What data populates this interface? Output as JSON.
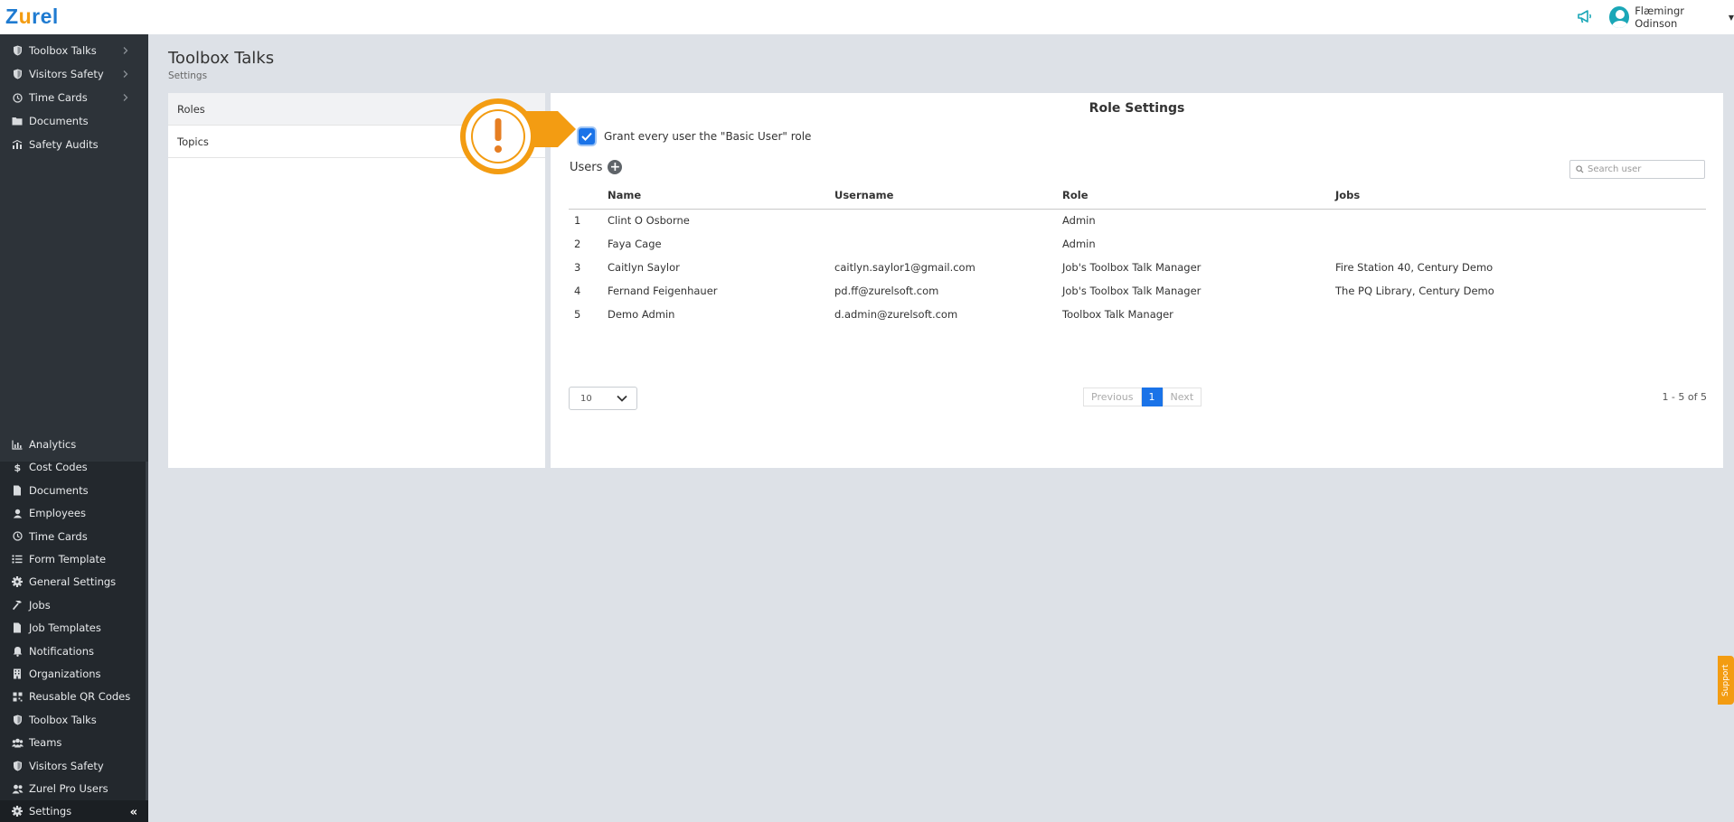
{
  "app": {
    "logo": "Zurel",
    "logo_pre": "Z",
    "logo_dot": "u",
    "logo_post": "rel"
  },
  "header": {
    "user_name": "Flæmingr Odinson",
    "icon": "megaphone-icon"
  },
  "sidebar": {
    "top_items": [
      {
        "label": "Toolbox Talks",
        "icon": "shield-icon",
        "has_children": true
      },
      {
        "label": "Visitors Safety",
        "icon": "shield-icon",
        "has_children": true
      },
      {
        "label": "Time Cards",
        "icon": "clock-icon",
        "has_children": true
      },
      {
        "label": "Documents",
        "icon": "folder-icon",
        "has_children": false
      },
      {
        "label": "Safety Audits",
        "icon": "audit-icon",
        "has_children": false
      }
    ],
    "bottom_items": [
      {
        "label": "Analytics",
        "icon": "chart-icon"
      },
      {
        "label": "Cost Codes",
        "icon": "dollar-icon"
      },
      {
        "label": "Documents",
        "icon": "file-icon"
      },
      {
        "label": "Employees",
        "icon": "user-icon"
      },
      {
        "label": "Time Cards",
        "icon": "clock-icon"
      },
      {
        "label": "Form Template",
        "icon": "list-icon"
      },
      {
        "label": "General Settings",
        "icon": "gear-icon"
      },
      {
        "label": "Jobs",
        "icon": "hammer-icon"
      },
      {
        "label": "Job Templates",
        "icon": "file-icon"
      },
      {
        "label": "Notifications",
        "icon": "bell-icon"
      },
      {
        "label": "Organizations",
        "icon": "building-icon"
      },
      {
        "label": "Reusable QR Codes",
        "icon": "qr-icon"
      },
      {
        "label": "Toolbox Talks",
        "icon": "shield-icon"
      },
      {
        "label": "Teams",
        "icon": "team-icon"
      },
      {
        "label": "Visitors Safety",
        "icon": "shield-icon"
      },
      {
        "label": "Zurel Pro Users",
        "icon": "users-icon"
      },
      {
        "label": "Settings",
        "icon": "gear-icon"
      }
    ]
  },
  "page": {
    "title": "Toolbox Talks",
    "subtitle": "Settings"
  },
  "tabs": [
    {
      "label": "Roles"
    },
    {
      "label": "Topics"
    }
  ],
  "role_settings": {
    "title": "Role Settings",
    "grant_label": "Grant every user the \"Basic User\" role",
    "grant_checked": true,
    "users_label": "Users",
    "search_placeholder": "Search user",
    "columns": [
      "Name",
      "Username",
      "Role",
      "Jobs"
    ],
    "rows": [
      {
        "num": "1",
        "name": "Clint O Osborne",
        "username": "",
        "role": "Admin",
        "jobs": ""
      },
      {
        "num": "2",
        "name": "Faya Cage",
        "username": "",
        "role": "Admin",
        "jobs": ""
      },
      {
        "num": "3",
        "name": "Caitlyn Saylor",
        "username": "caitlyn.saylor1@gmail.com",
        "role": "Job's Toolbox Talk Manager",
        "jobs": "Fire Station 40, Century Demo"
      },
      {
        "num": "4",
        "name": "Fernand Feigenhauer",
        "username": "pd.ff@zurelsoft.com",
        "role": "Job's Toolbox Talk Manager",
        "jobs": "The PQ Library, Century Demo"
      },
      {
        "num": "5",
        "name": "Demo Admin",
        "username": "d.admin@zurelsoft.com",
        "role": "Toolbox Talk Manager",
        "jobs": ""
      }
    ],
    "page_size": "10",
    "pagination": {
      "prev": "Previous",
      "current": "1",
      "next": "Next",
      "range": "1 - 5 of 5"
    }
  },
  "support_label": "Support",
  "colors": {
    "accent": "#1a73e8",
    "callout": "#f39c12",
    "sidebar": "#2d3339"
  }
}
